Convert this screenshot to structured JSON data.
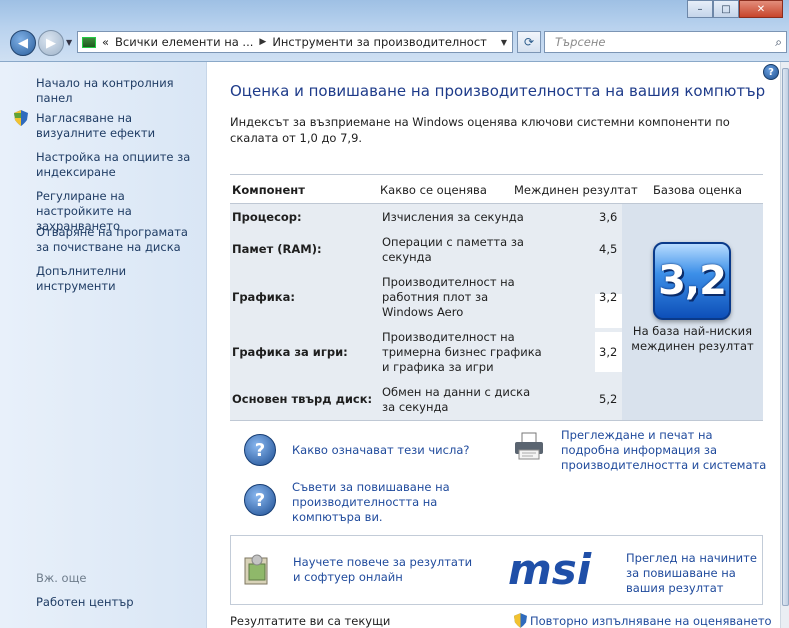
{
  "window": {
    "address": [
      "Всички елементи на ...",
      "Инструменти за производителност"
    ],
    "address_prefix": "«",
    "search_placeholder": "Търсене",
    "minimize": "–",
    "maximize": "□",
    "close": "✕"
  },
  "sidebar": {
    "home": "Начало на контролния панел",
    "links": [
      "Нагласяване на визуалните ефекти",
      "Настройка на опциите за индексиране",
      "Регулиране на настройките на захранването",
      "Отваряне на програмата за почистване на диска",
      "Допълнителни инструменти"
    ],
    "see_also": "Вж. още",
    "action_center": "Работен център"
  },
  "main": {
    "title": "Оценка и повишаване на производителността на вашия компютър",
    "intro": "Индексът за възприемане на Windows оценява ключови системни компоненти по скалата от 1,0 до 7,9.",
    "columns": [
      "Компонент",
      "Какво се оценява",
      "Междинен резултат",
      "Базова оценка"
    ],
    "rows": [
      {
        "component": "Процесор:",
        "rated": "Изчисления за секунда",
        "score": "3,6"
      },
      {
        "component": "Памет (RAM):",
        "rated": "Операции с паметта за секунда",
        "score": "4,5"
      },
      {
        "component": "Графика:",
        "rated": "Производителност на работния плот за Windows Aero",
        "score": "3,2"
      },
      {
        "component": "Графика за игри:",
        "rated": "Производителност на тримерна бизнес графика и графика за игри",
        "score": "3,2"
      },
      {
        "component": "Основен твърд диск:",
        "rated": "Обмен на данни с диска за секунда",
        "score": "5,2"
      }
    ],
    "base_score": "3,2",
    "base_caption": "На база най-ниския междинен резултат",
    "link_what": "Какво означават тези числа?",
    "link_tips": "Съвети за повишаване на производителността на компютъра ви.",
    "link_print": "Преглеждане и печат на подробна информация за производителността и системата",
    "promo_learn": "Научете повече за резултати и софтуер онлайн",
    "promo_msi": "Преглед на начините за повишаване на вашия резултат",
    "msi_logo": "msi",
    "status": "Резултатите ви са текущи",
    "rerun": "Повторно изпълняване на оценяването"
  }
}
